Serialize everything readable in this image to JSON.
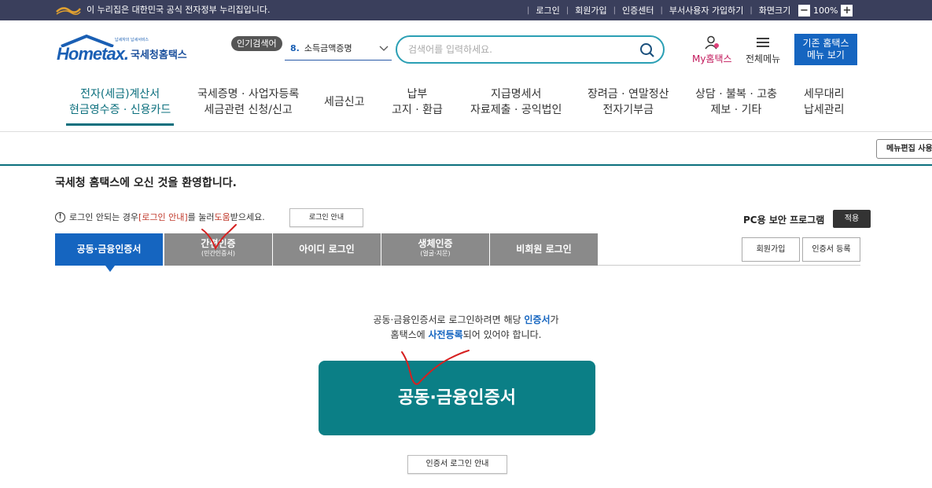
{
  "gov_bar": {
    "text": "이 누리집은 대한민국 공식 전자정부 누리집입니다.",
    "links": [
      "로그인",
      "회원가입",
      "인증센터",
      "부서사용자 가입하기",
      "화면크기"
    ],
    "zoom_minus": "−",
    "zoom_level": "100%",
    "zoom_plus": "+"
  },
  "header": {
    "logo_home": "Hometax.",
    "logo_kr": "국세청홈택스",
    "logo_small": "납세자의 납세서비스",
    "popular_label": "인기검색어",
    "popular_rank": "8.",
    "popular_term": "소득금액증명",
    "search_placeholder": "검색어를 입력하세요.",
    "my_label": "My홈택스",
    "all_menu_label": "전체메뉴",
    "legacy_line1": "기존 홈택스",
    "legacy_line2": "메뉴 보기"
  },
  "gnb": [
    {
      "l1": "전자(세금)계산서",
      "l2": "현금영수증 · 신용카드"
    },
    {
      "l1": "국세증명 · 사업자등록",
      "l2": "세금관련 신청/신고"
    },
    {
      "l1": "세금신고",
      "l2": ""
    },
    {
      "l1": "납부",
      "l2": "고지 · 환급"
    },
    {
      "l1": "지급명세서",
      "l2": "자료제출 · 공익법인"
    },
    {
      "l1": "장려금 · 연말정산",
      "l2": "전자기부금"
    },
    {
      "l1": "상담 · 불복 · 고충",
      "l2": "제보 · 기타"
    },
    {
      "l1": "세무대리",
      "l2": "납세관리"
    }
  ],
  "menu_edit": "메뉴편집 사용",
  "main": {
    "welcome": "국세청 홈택스에 오신 것을 환영합니다.",
    "notice_pre": "로그인 안되는 경우 ",
    "notice_red": "[로그인 안내]",
    "notice_mid": "를 눌러 ",
    "notice_red2": "도움",
    "notice_post": "받으세요.",
    "guide_button": "로그인 안내",
    "pc_security": "PC용 보안 프로그램",
    "apply_button": "적용",
    "tabs": [
      {
        "label": "공동·금융인증서",
        "sub": ""
      },
      {
        "label": "간편인증",
        "sub": "(민간인증서)"
      },
      {
        "label": "아이디 로그인",
        "sub": ""
      },
      {
        "label": "생체인증",
        "sub": "(얼굴·지문)"
      },
      {
        "label": "비회원 로그인",
        "sub": ""
      }
    ],
    "join_button": "회원가입",
    "cert_register_button": "인증서 등록",
    "desc1_pre": "공동·금융인증서로 로그인하려면 해당 ",
    "desc1_hl": "인증서",
    "desc1_post": "가",
    "desc2_pre": "홈택스에 ",
    "desc2_hl": "사전등록",
    "desc2_post": "되어 있어야 합니다.",
    "big_button": "공동·금융인증서",
    "cert_guide_button": "인증서 로그인 안내"
  },
  "colors": {
    "gov_bar": "#3a3f5c",
    "accent_teal": "#0b6f7d",
    "tab_active": "#1565c0",
    "big_button": "#0b7f86",
    "annotation_red": "#d62020"
  }
}
